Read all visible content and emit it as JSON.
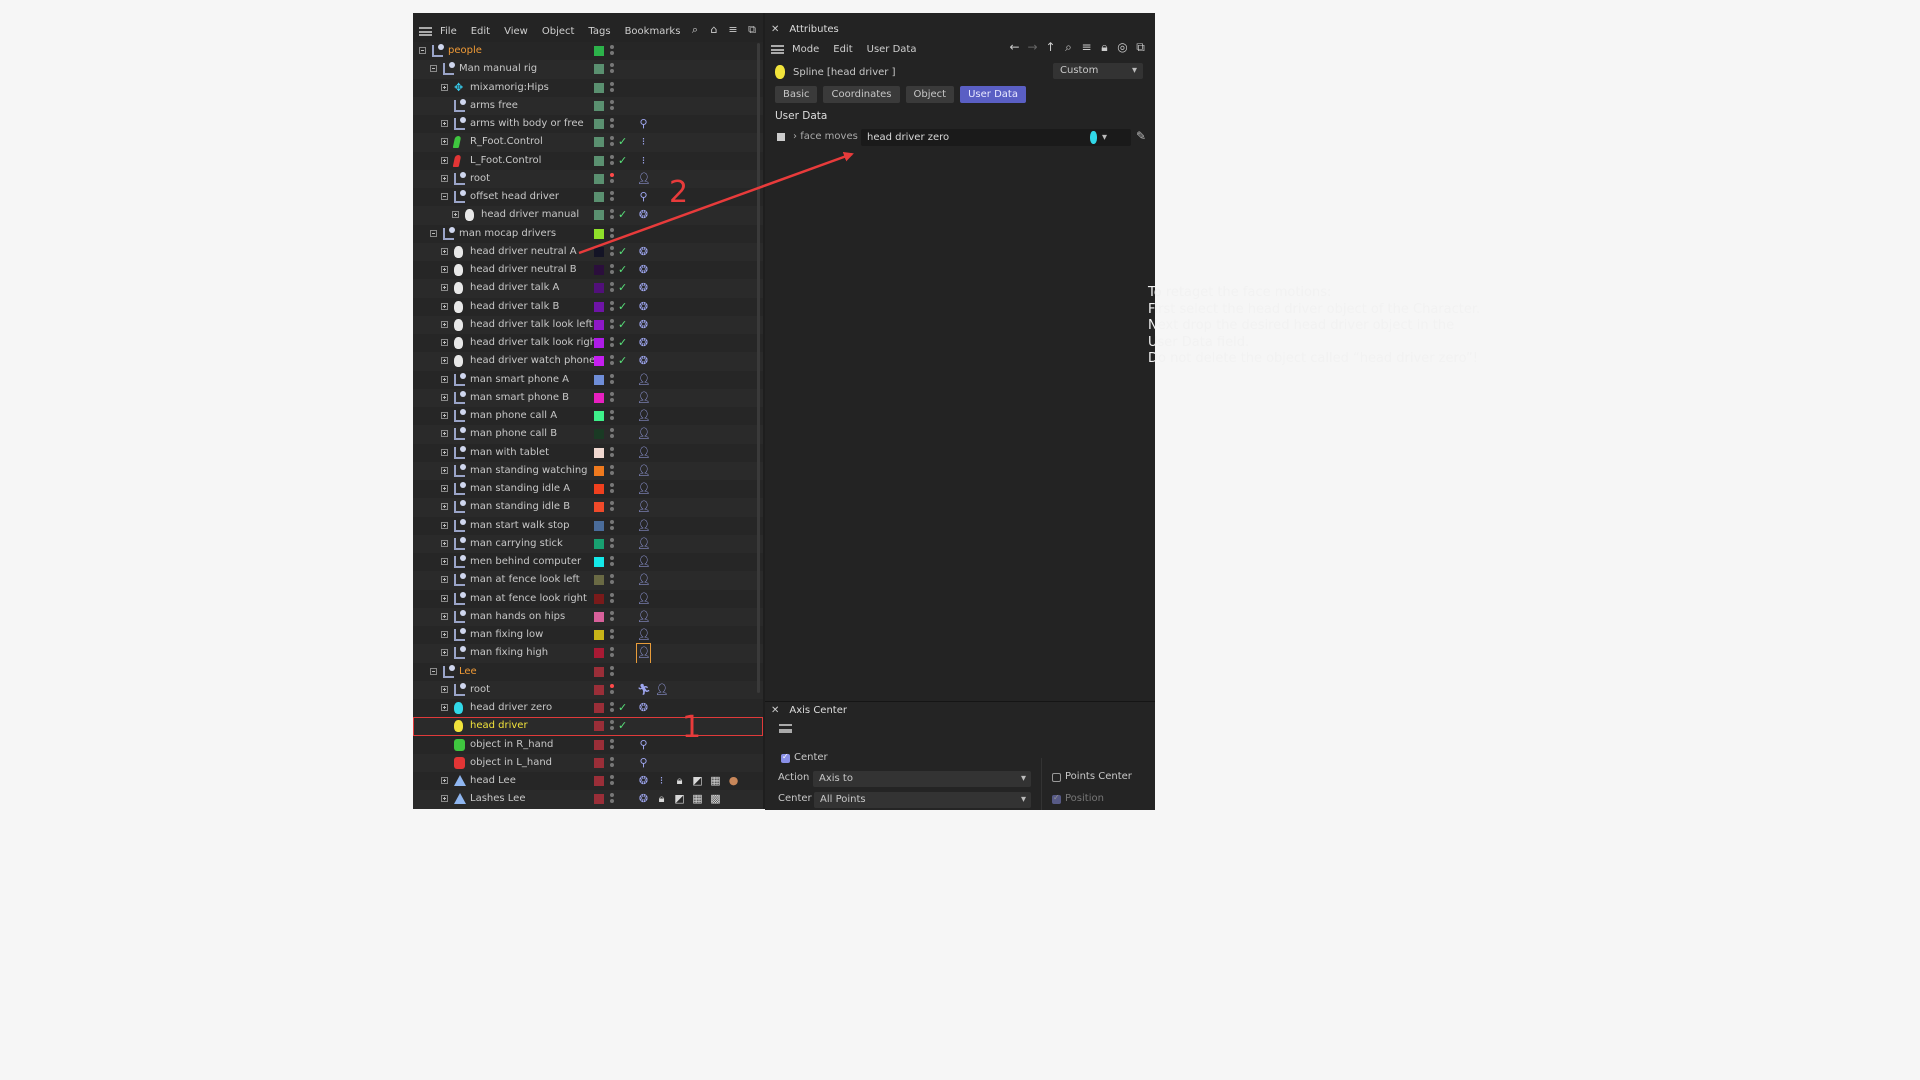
{
  "object_manager": {
    "menu": [
      "File",
      "Edit",
      "View",
      "Object",
      "Tags",
      "Bookmarks"
    ],
    "tool_icons": [
      "search-icon",
      "home-icon",
      "filter-icon",
      "new-window-icon"
    ],
    "rows": [
      {
        "name": "people",
        "depth": 0,
        "expander": "minus",
        "icon": "null",
        "swatch": "#2cb24a",
        "check": false,
        "tags": [],
        "name_color": "orange"
      },
      {
        "name": "Man manual rig",
        "depth": 1,
        "expander": "minus",
        "icon": "null",
        "swatch": "#5a9070",
        "check": false,
        "tags": []
      },
      {
        "name": "mixamorig:Hips",
        "depth": 2,
        "expander": "plus",
        "icon": "bone",
        "swatch": "#5a9070",
        "check": false,
        "tags": []
      },
      {
        "name": "arms free",
        "depth": 2,
        "expander": "none",
        "icon": "null",
        "swatch": "#5a9070",
        "check": false,
        "tags": []
      },
      {
        "name": "arms with body or free",
        "depth": 2,
        "expander": "plus",
        "icon": "null",
        "swatch": "#5a9070",
        "check": false,
        "tags": [
          "pin"
        ]
      },
      {
        "name": "R_Foot.Control",
        "depth": 2,
        "expander": "plus",
        "icon": "foot-g",
        "swatch": "#5a9070",
        "check": true,
        "tags": [
          "ik"
        ]
      },
      {
        "name": "L_Foot.Control",
        "depth": 2,
        "expander": "plus",
        "icon": "foot-r",
        "swatch": "#5a9070",
        "check": true,
        "tags": [
          "ik"
        ]
      },
      {
        "name": "root",
        "depth": 2,
        "expander": "plus",
        "icon": "null",
        "swatch": "#5a9070",
        "check": false,
        "tags": [
          "person"
        ],
        "red_dot": true
      },
      {
        "name": "offset head driver",
        "depth": 2,
        "expander": "minus",
        "icon": "null",
        "swatch": "#5a9070",
        "check": false,
        "tags": [
          "pin"
        ]
      },
      {
        "name": "head driver manual",
        "depth": 3,
        "expander": "plus",
        "icon": "face",
        "swatch": "#5a9070",
        "check": true,
        "tags": [
          "pose"
        ]
      },
      {
        "name": "man mocap drivers",
        "depth": 1,
        "expander": "minus",
        "icon": "null",
        "swatch": "#8fe02a",
        "check": false,
        "tags": []
      },
      {
        "name": "head driver  neutral A",
        "depth": 2,
        "expander": "plus",
        "icon": "face",
        "swatch": "#141426",
        "check": true,
        "tags": [
          "pose"
        ]
      },
      {
        "name": "head driver  neutral B",
        "depth": 2,
        "expander": "plus",
        "icon": "face",
        "swatch": "#2b0e3c",
        "check": true,
        "tags": [
          "pose"
        ]
      },
      {
        "name": "head driver  talk A",
        "depth": 2,
        "expander": "plus",
        "icon": "face",
        "swatch": "#51107a",
        "check": true,
        "tags": [
          "pose"
        ]
      },
      {
        "name": "head driver  talk B",
        "depth": 2,
        "expander": "plus",
        "icon": "face",
        "swatch": "#6e14a6",
        "check": true,
        "tags": [
          "pose"
        ]
      },
      {
        "name": "head driver  talk look left",
        "depth": 2,
        "expander": "plus",
        "icon": "face",
        "swatch": "#8e18c8",
        "check": true,
        "tags": [
          "pose"
        ]
      },
      {
        "name": "head driver  talk look right",
        "depth": 2,
        "expander": "plus",
        "icon": "face",
        "swatch": "#ad1ce8",
        "check": true,
        "tags": [
          "pose"
        ]
      },
      {
        "name": "head driver  watch phone",
        "depth": 2,
        "expander": "plus",
        "icon": "face",
        "swatch": "#c51ef0",
        "check": true,
        "tags": [
          "pose"
        ]
      },
      {
        "name": "man smart phone A",
        "depth": 2,
        "expander": "plus",
        "icon": "null",
        "swatch": "#6f8ed8",
        "check": false,
        "tags": [
          "person"
        ]
      },
      {
        "name": "man smart phone B",
        "depth": 2,
        "expander": "plus",
        "icon": "null",
        "swatch": "#e820c0",
        "check": false,
        "tags": [
          "person"
        ]
      },
      {
        "name": "man phone call A",
        "depth": 2,
        "expander": "plus",
        "icon": "null",
        "swatch": "#3ef08a",
        "check": false,
        "tags": [
          "person"
        ]
      },
      {
        "name": "man phone call B",
        "depth": 2,
        "expander": "plus",
        "icon": "null",
        "swatch": "#1a3a24",
        "check": false,
        "tags": [
          "person"
        ]
      },
      {
        "name": "man with tablet",
        "depth": 2,
        "expander": "plus",
        "icon": "null",
        "swatch": "#f0d8d0",
        "check": false,
        "tags": [
          "person"
        ]
      },
      {
        "name": "man standing watching",
        "depth": 2,
        "expander": "plus",
        "icon": "null",
        "swatch": "#f07a1e",
        "check": false,
        "tags": [
          "person"
        ]
      },
      {
        "name": "man standing idle A",
        "depth": 2,
        "expander": "plus",
        "icon": "null",
        "swatch": "#f0401e",
        "check": false,
        "tags": [
          "person"
        ]
      },
      {
        "name": "man standing idle B",
        "depth": 2,
        "expander": "plus",
        "icon": "null",
        "swatch": "#f04a2a",
        "check": false,
        "tags": [
          "person"
        ]
      },
      {
        "name": "man start walk stop",
        "depth": 2,
        "expander": "plus",
        "icon": "null",
        "swatch": "#4a6c9a",
        "check": false,
        "tags": [
          "person"
        ]
      },
      {
        "name": "man carrying stick",
        "depth": 2,
        "expander": "plus",
        "icon": "null",
        "swatch": "#18a070",
        "check": false,
        "tags": [
          "person"
        ]
      },
      {
        "name": "men behind computer",
        "depth": 2,
        "expander": "plus",
        "icon": "null",
        "swatch": "#14e8e8",
        "check": false,
        "tags": [
          "person"
        ]
      },
      {
        "name": "man at fence look left",
        "depth": 2,
        "expander": "plus",
        "icon": "null",
        "swatch": "#6a6a44",
        "check": false,
        "tags": [
          "person"
        ]
      },
      {
        "name": "man at fence look right",
        "depth": 2,
        "expander": "plus",
        "icon": "null",
        "swatch": "#7a1a1a",
        "check": false,
        "tags": [
          "person"
        ]
      },
      {
        "name": "man hands on hips",
        "depth": 2,
        "expander": "plus",
        "icon": "null",
        "swatch": "#d8609a",
        "check": false,
        "tags": [
          "person"
        ]
      },
      {
        "name": "man fixing low",
        "depth": 2,
        "expander": "plus",
        "icon": "null",
        "swatch": "#c8b418",
        "check": false,
        "tags": [
          "person"
        ]
      },
      {
        "name": "man fixing high",
        "depth": 2,
        "expander": "plus",
        "icon": "null",
        "swatch": "#a81a34",
        "check": false,
        "tags": [
          "person-selected"
        ]
      },
      {
        "name": "Lee",
        "depth": 1,
        "expander": "minus",
        "icon": "null",
        "swatch": "#9a2e38",
        "check": false,
        "tags": [],
        "name_color": "orange"
      },
      {
        "name": "root",
        "depth": 2,
        "expander": "plus",
        "icon": "null",
        "swatch": "#9a2e38",
        "check": false,
        "tags": [
          "walk",
          "person"
        ],
        "red_dot": true
      },
      {
        "name": "head driver zero",
        "depth": 2,
        "expander": "plus",
        "icon": "face-cyan",
        "swatch": "#9a2e38",
        "check": true,
        "tags": [
          "pose"
        ]
      },
      {
        "name": "head driver",
        "depth": 2,
        "expander": "none",
        "icon": "face-yellow",
        "swatch": "#9a2e38",
        "check": true,
        "tags": [],
        "name_color": "yellow",
        "highlight": true
      },
      {
        "name": "object in R_hand",
        "depth": 2,
        "expander": "none",
        "icon": "hand-g",
        "swatch": "#9a2e38",
        "check": false,
        "tags": [
          "pin"
        ]
      },
      {
        "name": "object in L_hand",
        "depth": 2,
        "expander": "none",
        "icon": "hand-r",
        "swatch": "#9a2e38",
        "check": false,
        "tags": [
          "pin"
        ]
      },
      {
        "name": "head Lee",
        "depth": 2,
        "expander": "plus",
        "icon": "tri",
        "swatch": "#9a2e38",
        "check": false,
        "tags": [
          "pose",
          "ik",
          "lock",
          "uvw",
          "checker",
          "sphere"
        ]
      },
      {
        "name": "Lashes Lee",
        "depth": 2,
        "expander": "plus",
        "icon": "tri",
        "swatch": "#9a2e38",
        "check": false,
        "tags": [
          "pose",
          "lock",
          "uvw",
          "checker",
          "texture"
        ]
      }
    ]
  },
  "attributes": {
    "title": "Attributes",
    "menu": [
      "Mode",
      "Edit",
      "User Data"
    ],
    "tool_icons": [
      "back-arrow-icon",
      "forward-arrow-icon",
      "up-arrow-icon",
      "search-icon",
      "filter-icon",
      "lock-icon",
      "target-icon",
      "new-window-icon"
    ],
    "object_name": "Spline [head driver ]",
    "mode_dropdown": "Custom",
    "tabs": [
      "Basic",
      "Coordinates",
      "Object",
      "User Data"
    ],
    "active_tab": 3,
    "section_title": "User Data",
    "field_label": "face moves",
    "field_value": "head driver zero"
  },
  "note": {
    "text": "To retaget the face motions:\nFirst select the head driver object of the Character.\nNext drop the desired head driver object in the\nUser Data field.\nDo not delete the object called “head driver zero”!"
  },
  "axis_center": {
    "title": "Axis Center",
    "center_label": "Center",
    "center_checked": true,
    "action_label": "Action",
    "action_value": "Axis to",
    "center_select_label": "Center",
    "center_select_value": "All Points",
    "points_center_label": "Points Center",
    "points_center_checked": false,
    "position_label": "Position",
    "position_checked": true
  },
  "annotations": {
    "label_1": "1",
    "label_2": "2",
    "color": "#e83b3b"
  }
}
